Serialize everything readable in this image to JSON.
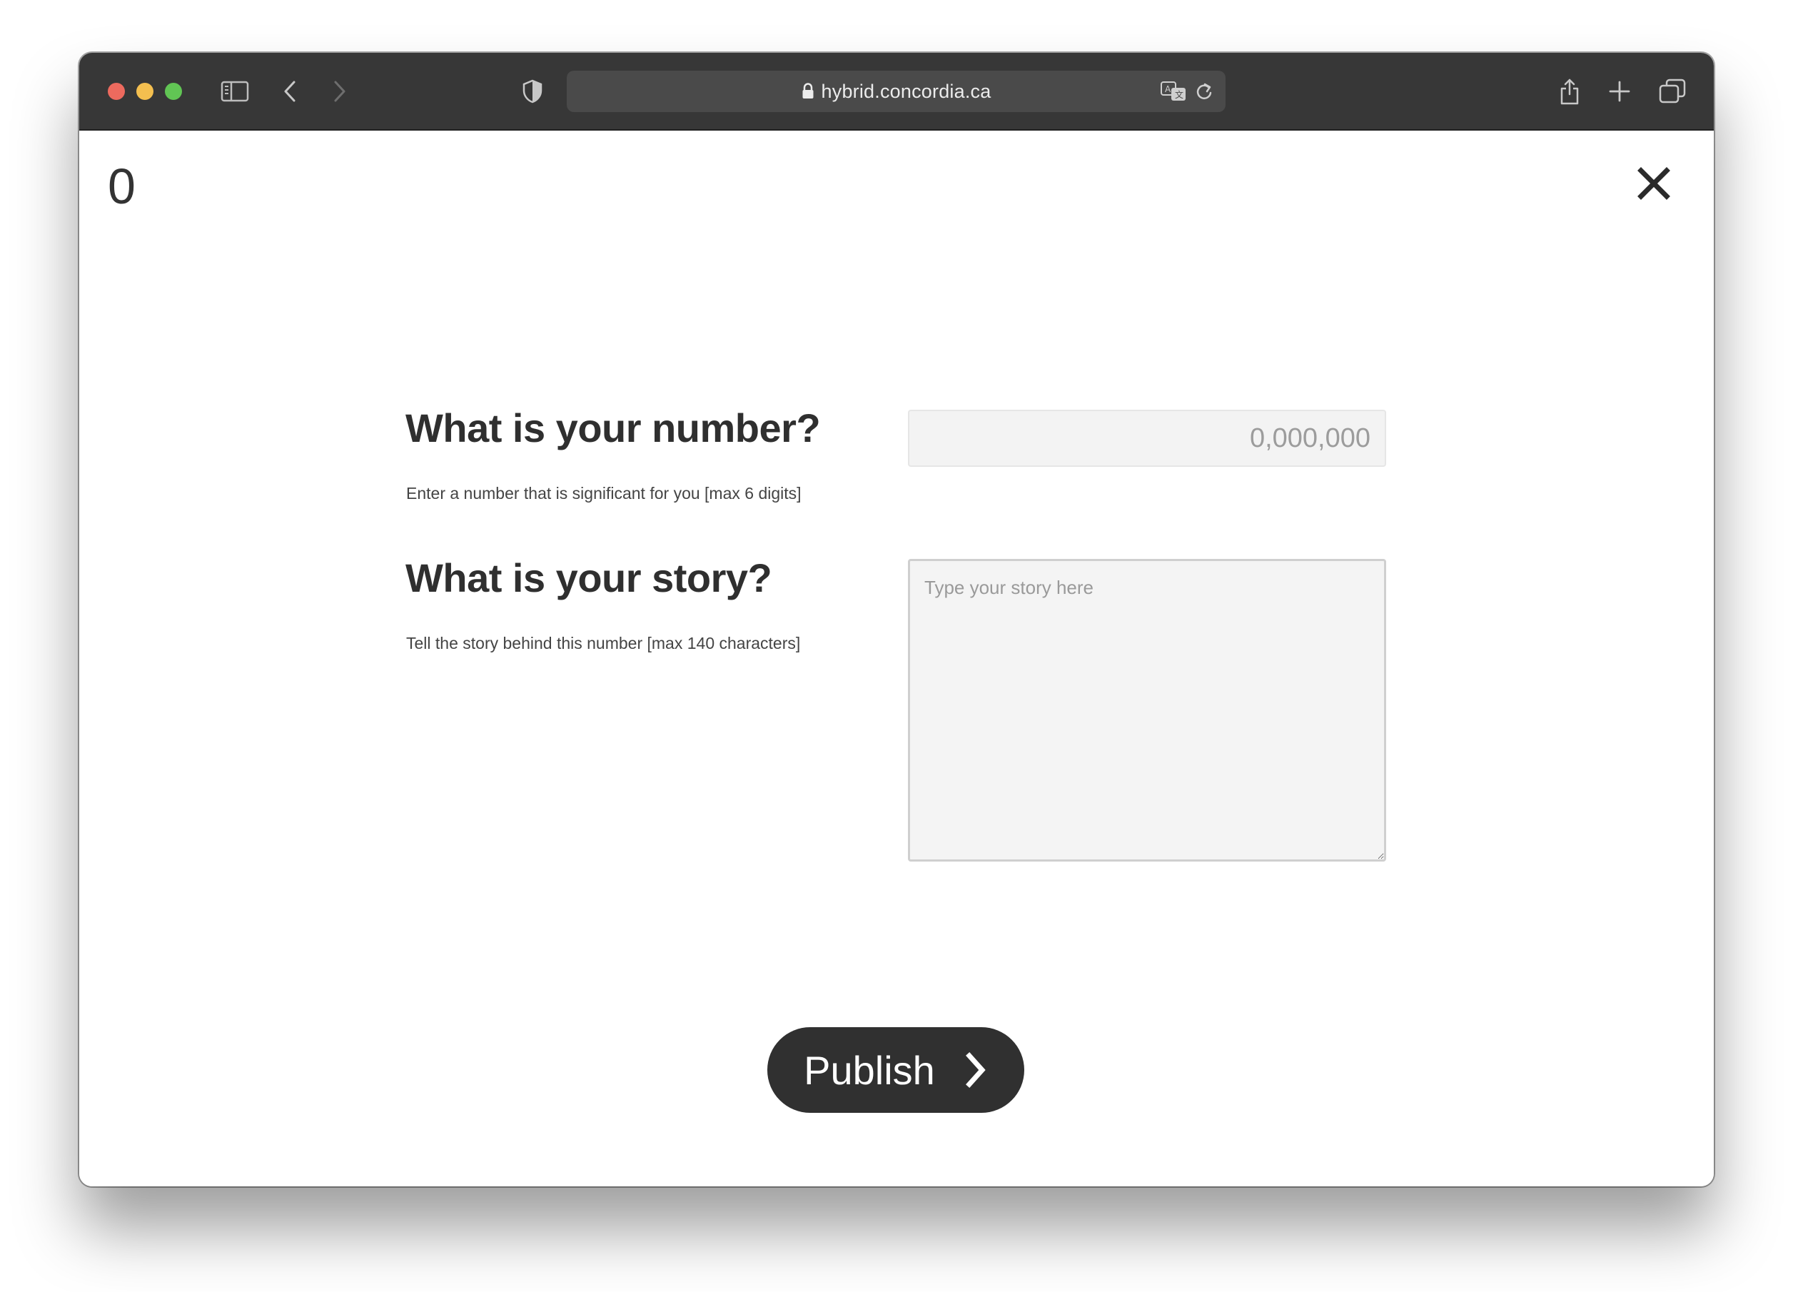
{
  "browser": {
    "url": "hybrid.concordia.ca",
    "icons": [
      "sidebar-icon",
      "back-icon",
      "forward-icon",
      "shield-icon",
      "lock-icon",
      "translate-icon",
      "reload-icon",
      "share-icon",
      "new-tab-icon",
      "tabs-overview-icon"
    ]
  },
  "page": {
    "counter": "0",
    "close_icon": "close-icon"
  },
  "form": {
    "number": {
      "heading": "What is your number?",
      "hint": "Enter a number that is significant for you [max 6 digits]",
      "placeholder": "0,000,000",
      "value": ""
    },
    "story": {
      "heading": "What is your story?",
      "hint": "Tell the story behind this number [max 140 characters]",
      "placeholder": "Type your story here",
      "value": ""
    },
    "submit": {
      "label": "Publish",
      "icon": "chevron-right-icon"
    }
  },
  "colors": {
    "toolbar": "#373737",
    "button": "#303030",
    "input_bg": "#f3f3f3",
    "text": "#2f2f2f"
  }
}
